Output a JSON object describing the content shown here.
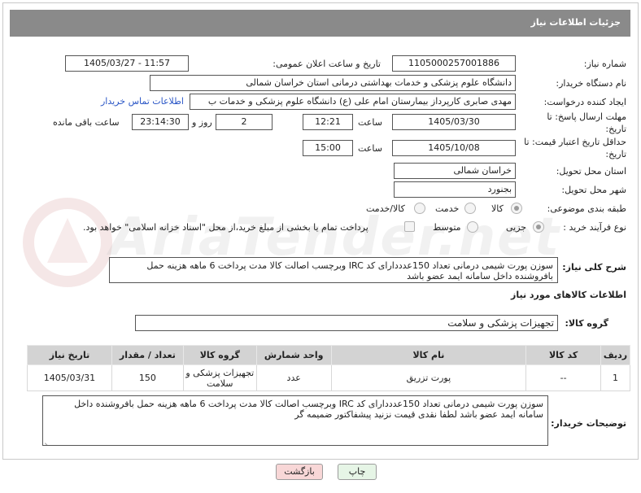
{
  "header": {
    "title": "جزئیات اطلاعات نیاز"
  },
  "labels": {
    "need_number": "شماره نیاز:",
    "announce_datetime": "تاریخ و ساعت اعلان عمومی:",
    "buyer_org": "نام دستگاه خریدار:",
    "requester": "ایجاد کننده درخواست:",
    "reply_deadline": "مهلت ارسال پاسخ: تا تاریخ:",
    "price_validity": "حداقل تاریخ اعتبار قیمت: تا تاریخ:",
    "time": "ساعت",
    "day_and": "روز و",
    "time_remaining": "ساعت باقی مانده",
    "delivery_province": "استان محل تحویل:",
    "delivery_city": "شهر محل تحویل:",
    "category": "طبقه بندی موضوعی:",
    "purchase_process": "نوع فرآیند خرید :",
    "general_desc": "شرح کلی نیاز:",
    "goods_info": "اطلاعات کالاهای مورد نیاز",
    "goods_group": "گروه کالا:",
    "buyer_notes": "توضیحات خریدار:"
  },
  "fields": {
    "need_number": "1105000257001886",
    "announce_datetime": "1405/03/27 - 11:57",
    "buyer_org": "دانشگاه علوم پزشکی و خدمات بهداشتی درمانی استان خراسان شمالی",
    "requester": "مهدی صابری کارپرداز بیمارستان امام علی (ع) دانشگاه علوم پزشکی و خدمات ب",
    "contact_link": "اطلاعات تماس خریدار",
    "reply_date": "1405/03/30",
    "reply_time": "12:21",
    "reply_days": "2",
    "reply_remaining": "23:14:30",
    "validity_date": "1405/10/08",
    "validity_time": "15:00",
    "province": "خراسان شمالی",
    "city": "بجنورد"
  },
  "category_options": [
    "کالا",
    "خدمت",
    "کالا/خدمت"
  ],
  "process_options": [
    "جزیی",
    "متوسط"
  ],
  "payment_note": "پرداخت تمام یا بخشی از مبلغ خرید،از محل \"اسناد خزانه اسلامی\" خواهد بود.",
  "general_description": "سوزن پورت شیمی درمانی تعداد 150عدددارای کد IRC وبرچسب اصالت  کالا مدت پرداخت 6 ماهه هزینه حمل بافروشنده داخل سامانه ایمد عضو باشد",
  "goods_group_value": "تجهیزات پزشکی و سلامت",
  "table": {
    "headers": [
      "ردیف",
      "کد کالا",
      "نام کالا",
      "واحد شمارش",
      "گروه کالا",
      "تعداد / مقدار",
      "تاریخ نیاز"
    ],
    "rows": [
      [
        "1",
        "--",
        "پورت تزریق",
        "عدد",
        "تجهیزات پزشکی و سلامت",
        "150",
        "1405/03/31"
      ]
    ]
  },
  "buyer_notes_text": "سوزن پورت شیمی درمانی تعداد 150عدددارای کد IRC وبرچسب اصالت  کالا مدت پرداخت 6 ماهه هزینه حمل بافروشنده داخل سامانه ایمد عضو باشد لطفا نقدی قیمت نزنید پیشفاکتور ضمیمه گر",
  "buttons": {
    "print": "چاپ",
    "back": "بازگشت"
  },
  "watermark": "AriaTender.net",
  "colors": {
    "header_bg": "#8a8a8a",
    "table_header_bg": "#d3d3d3",
    "link": "#2a56c6",
    "back_button_bg": "#f8d7d7",
    "print_button_bg": "#e6f5e6"
  }
}
